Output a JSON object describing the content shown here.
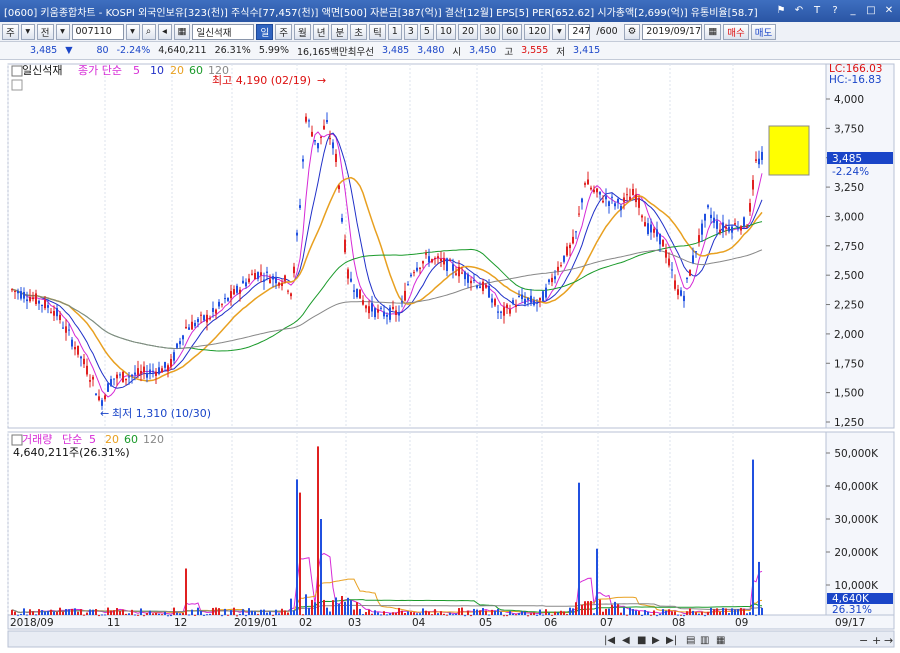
{
  "title_bar": {
    "text": "[0600] 키움종합차트 - KOSPI 외국인보유[323(천)] 주식수[77,457(천)] 액면[500] 자본금[387(억)] 결산[12월] EPS[5] PER[652.62] 시가총액[2,699(억)] 유통비율[58.7]",
    "icons": [
      "pin-icon",
      "undo-icon",
      "text-icon",
      "help-icon",
      "minimize-icon",
      "maximize-icon",
      "close-icon"
    ]
  },
  "toolbar": {
    "type_select": "주",
    "market_select": "전",
    "code": "007110",
    "name": "일신석재",
    "period_buttons": [
      "일",
      "주",
      "월",
      "년",
      "분",
      "초",
      "틱"
    ],
    "active_period": "일",
    "interval_buttons": [
      "1",
      "3",
      "5",
      "10",
      "20",
      "30",
      "60",
      "120"
    ],
    "count": "247",
    "count_max": "/600",
    "date": "2019/09/17",
    "buy_label": "매수",
    "sell_label": "매도"
  },
  "quote": {
    "price": "3,485",
    "arrow": "▼",
    "change": "80",
    "change_pct": "-2.24%",
    "volume": "4,640,211",
    "vol_pct": "26.31%",
    "turnover_pct": "5.99%",
    "amount": "16,165백만",
    "priority_label": "최우선",
    "bid": "3,485",
    "ask": "3,480",
    "open_label": "시",
    "open": "3,450",
    "high_label": "고",
    "high": "3,555",
    "low_label": "저",
    "low": "3,415"
  },
  "price_panel": {
    "title": "일신석재",
    "legend_label": "종가 단순",
    "ma_periods": [
      {
        "label": "5",
        "color": "#d62ad6"
      },
      {
        "label": "10",
        "color": "#2030c8"
      },
      {
        "label": "20",
        "color": "#e8a020"
      },
      {
        "label": "60",
        "color": "#1a9a2a"
      },
      {
        "label": "120",
        "color": "#888888"
      }
    ],
    "high_marker": "최고 4,190 (02/19)",
    "low_marker": "최저 1,310 (10/30)",
    "lc": "LC:166.03",
    "hc": "HC:-16.83",
    "current_price": "3,485",
    "current_change": "-2.24%",
    "y_ticks": [
      "4,000",
      "3,750",
      "3,500",
      "3,250",
      "3,000",
      "2,750",
      "2,500",
      "2,250",
      "2,000",
      "1,750",
      "1,500",
      "1,250"
    ]
  },
  "volume_panel": {
    "legend_label": "거래량",
    "legend_ma": "단순",
    "ma_periods": [
      {
        "label": "5",
        "color": "#d62ad6"
      },
      {
        "label": "20",
        "color": "#e8a020"
      },
      {
        "label": "60",
        "color": "#1a9a2a"
      },
      {
        "label": "120",
        "color": "#888888"
      }
    ],
    "info": "4,640,211주(26.31%)",
    "y_ticks": [
      "50,000K",
      "40,000K",
      "30,000K",
      "20,000K",
      "10,000K"
    ],
    "current_volume": "4,640K",
    "current_pct": "26.31%"
  },
  "x_axis": {
    "labels": [
      "2018/09",
      "11",
      "12",
      "2019/01",
      "02",
      "03",
      "04",
      "05",
      "06",
      "07",
      "08",
      "09"
    ],
    "end_date": "09/17"
  },
  "scroll_controls": [
    "first-icon",
    "prev-icon",
    "stop-icon",
    "next-icon",
    "last-icon",
    "minus-icon",
    "plus-icon",
    "arrow-icon"
  ],
  "colors": {
    "up": "#e02020",
    "down": "#2050e0",
    "background": "#ffffff",
    "highlight_box": "#ffff00"
  }
}
